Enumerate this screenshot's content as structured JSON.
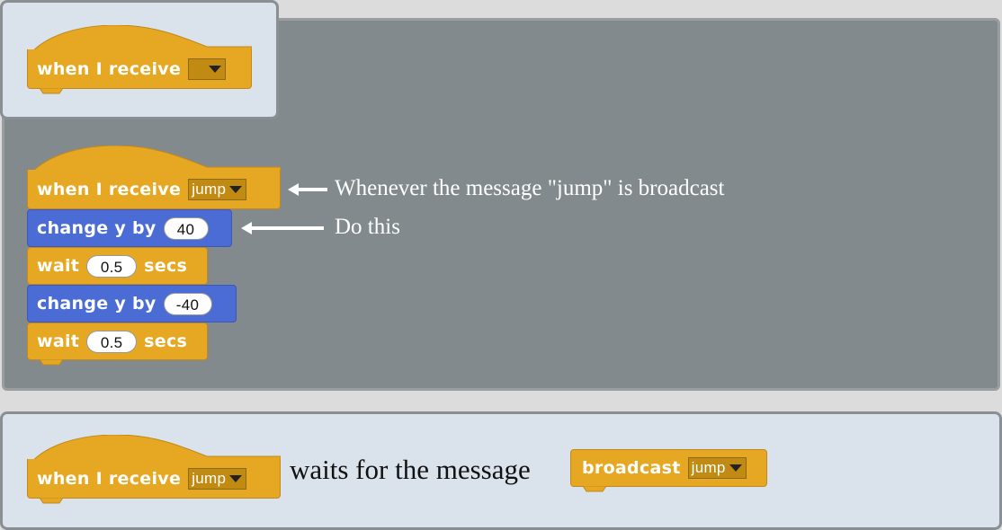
{
  "top_example": {
    "hat_label": "when I receive",
    "dropdown_value": ""
  },
  "script": {
    "hat_label": "when I receive",
    "hat_dropdown": "jump",
    "blocks": [
      {
        "label": "change y by",
        "value": "40",
        "category": "motion"
      },
      {
        "label": "wait",
        "value": "0.5",
        "suffix": "secs",
        "category": "control"
      },
      {
        "label": "change y by",
        "value": "-40",
        "category": "motion"
      },
      {
        "label": "wait",
        "value": "0.5",
        "suffix": "secs",
        "category": "control"
      }
    ]
  },
  "annotations": {
    "hat_note": "Whenever the message \"jump\" is broadcast",
    "do_note": "Do this"
  },
  "bottom": {
    "hat_label": "when I receive",
    "hat_dropdown": "jump",
    "middle_text": "waits for the message",
    "broadcast_label": "broadcast",
    "broadcast_dropdown": "jump"
  },
  "colors": {
    "events": "#e6a822",
    "motion": "#4a6cd4",
    "panel_dark": "#838a8d",
    "panel_light": "#dae2ec"
  }
}
